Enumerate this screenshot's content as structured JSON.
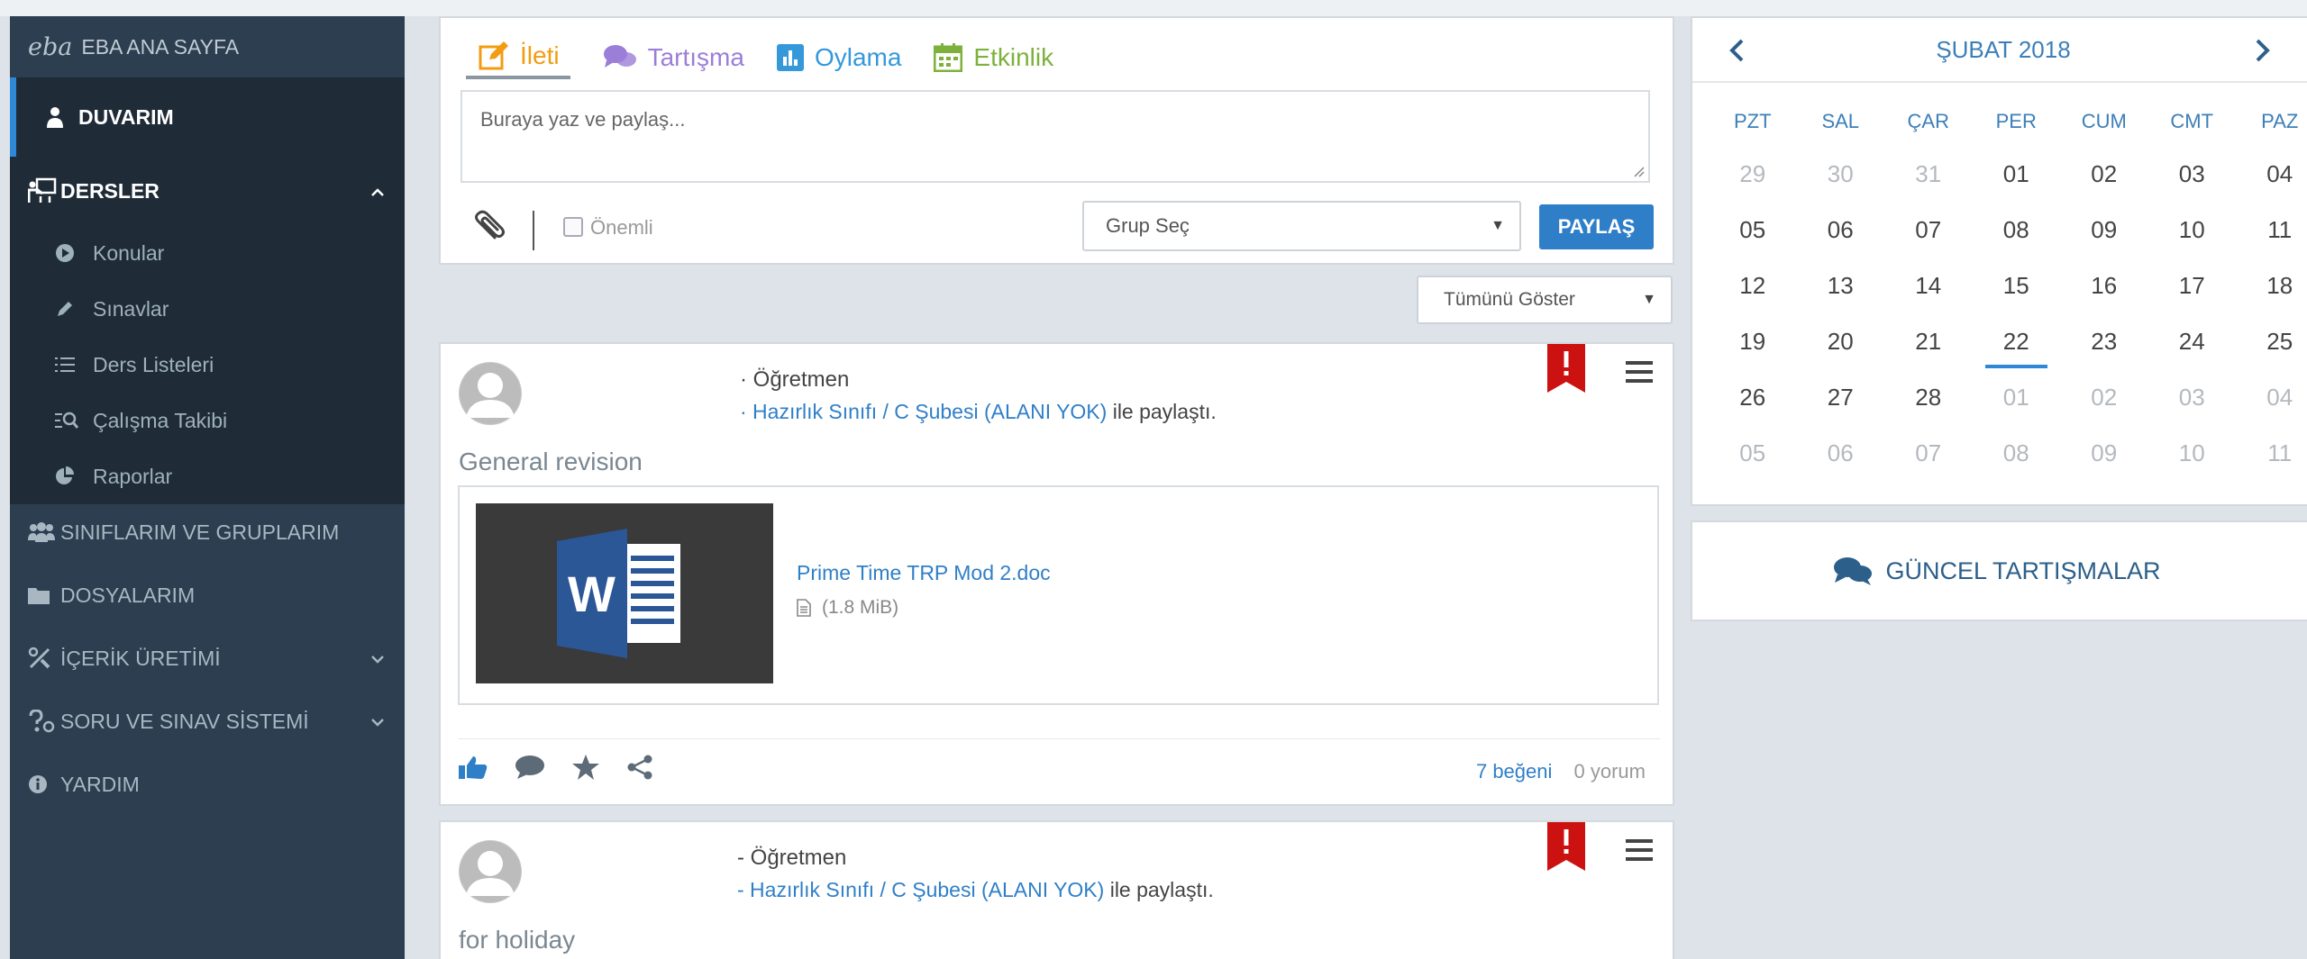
{
  "sidebar": {
    "logo": "eba",
    "home": "EBA ANA SAYFA",
    "duvarim": "DUVARIM",
    "dersler": "DERSLER",
    "sub": [
      "Konular",
      "Sınavlar",
      "Ders Listeleri",
      "Çalışma Takibi",
      "Raporlar"
    ],
    "siniflar": "SINIFLARIM VE GRUPLARIM",
    "dosyalar": "DOSYALARIM",
    "icerik": "İÇERİK ÜRETİMİ",
    "soru": "SORU VE SINAV SİSTEMİ",
    "yardim": "YARDIM"
  },
  "composer": {
    "tabs": [
      "İleti",
      "Tartışma",
      "Oylama",
      "Etkinlik"
    ],
    "placeholder": "Buraya yaz ve paylaş...",
    "important": "Önemli",
    "group_select": "Grup Seç",
    "share_button": "PAYLAŞ"
  },
  "filter": {
    "value": "Tümünü Göster"
  },
  "posts": [
    {
      "author_role": "· Öğretmen",
      "shared_with": "· Hazırlık Sınıfı / C Şubesi (ALANI YOK)",
      "shared_suffix": " ile paylaştı.",
      "title": "General revision",
      "file_name": "Prime Time TRP Mod 2.doc",
      "file_size": "(1.8 MiB)",
      "likes": "7 beğeni",
      "comments": "0 yorum"
    },
    {
      "author_role": "- Öğretmen",
      "shared_with": "- Hazırlık Sınıfı / C Şubesi (ALANI YOK)",
      "shared_suffix": " ile paylaştı.",
      "title": "for holiday"
    }
  ],
  "calendar": {
    "title": "ŞUBAT 2018",
    "weekdays": [
      "PZT",
      "SAL",
      "ÇAR",
      "PER",
      "CUM",
      "CMT",
      "PAZ"
    ],
    "weeks": [
      [
        "29",
        "30",
        "31",
        "01",
        "02",
        "03",
        "04"
      ],
      [
        "05",
        "06",
        "07",
        "08",
        "09",
        "10",
        "11"
      ],
      [
        "12",
        "13",
        "14",
        "15",
        "16",
        "17",
        "18"
      ],
      [
        "19",
        "20",
        "21",
        "22",
        "23",
        "24",
        "25"
      ],
      [
        "26",
        "27",
        "28",
        "01",
        "02",
        "03",
        "04"
      ],
      [
        "05",
        "06",
        "07",
        "08",
        "09",
        "10",
        "11"
      ]
    ],
    "today": "22"
  },
  "discussions": {
    "label": "GÜNCEL TARTIŞMALAR"
  },
  "colors": {
    "accent": "#2f7fc8",
    "sidebar": "#2c3e4f",
    "ileti": "#f39c12",
    "tartisma": "#9b7ed8",
    "etkinlik": "#7db13c"
  }
}
